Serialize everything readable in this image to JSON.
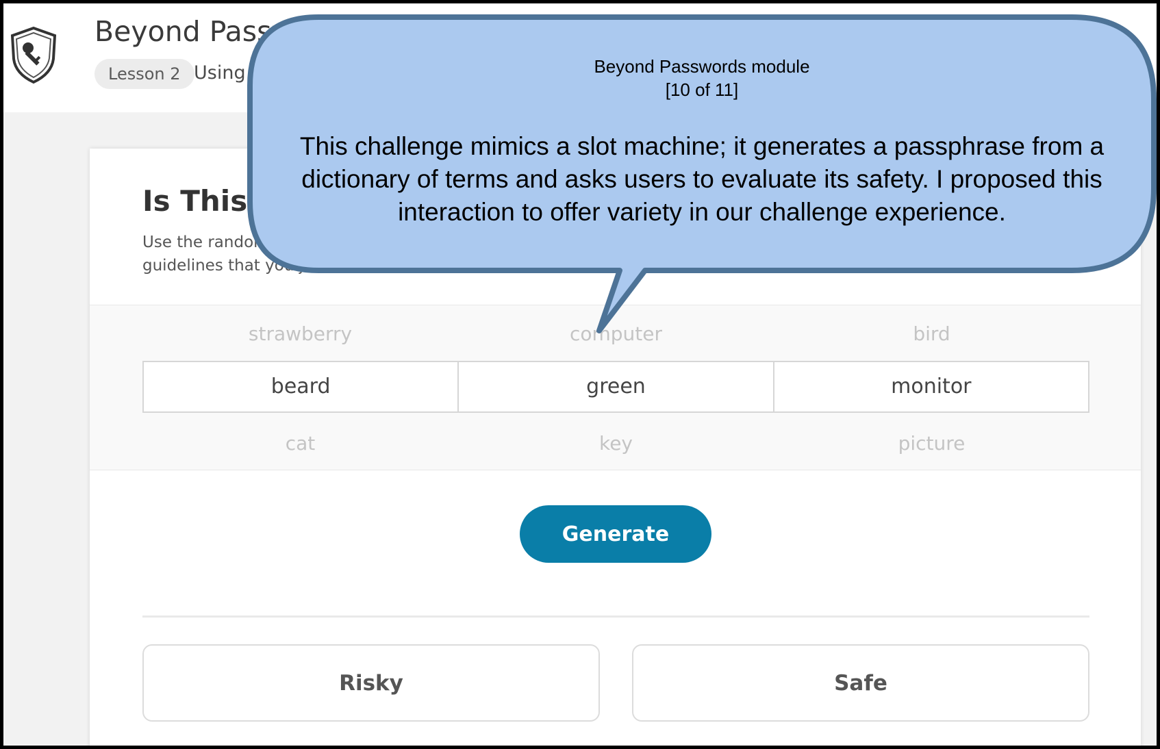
{
  "header": {
    "course_title": "Beyond Passw",
    "lesson_badge": "Lesson 2",
    "lesson_name": "Using P"
  },
  "card": {
    "title": "Is This P",
    "description_line1": "Use the random",
    "description_line2": "guidelines that you j"
  },
  "slot_machine": {
    "top_row": [
      "strawberry",
      "computer",
      "bird"
    ],
    "selected_row": [
      "beard",
      "green",
      "monitor"
    ],
    "bottom_row": [
      "cat",
      "key",
      "picture"
    ]
  },
  "buttons": {
    "generate_label": "Generate",
    "risky_label": "Risky",
    "safe_label": "Safe"
  },
  "callout": {
    "module": "Beyond Passwords module",
    "progress": "[10 of 11]",
    "body": "This challenge mimics a slot machine; it generates a passphrase from a dictionary of terms and asks users to evaluate its safety. I proposed this interaction to offer variety in our challenge experience."
  },
  "colors": {
    "primary_button": "#0a7ea8",
    "callout_fill": "#abc9ef",
    "callout_stroke": "#4d7397"
  },
  "icons": {
    "logo": "shield-key-icon"
  }
}
